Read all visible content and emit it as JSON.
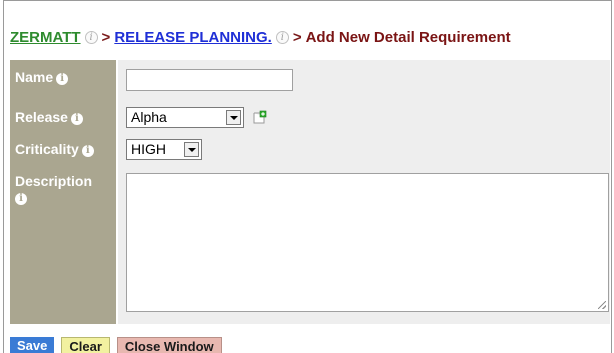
{
  "breadcrumb": {
    "project": "ZERMATT",
    "separator": ">",
    "module": "RELEASE PLANNING.",
    "current": "Add New Detail Requirement"
  },
  "form": {
    "name": {
      "label": "Name",
      "value": ""
    },
    "release": {
      "label": "Release",
      "selected": "Alpha"
    },
    "criticality": {
      "label": "Criticality",
      "selected": "HIGH"
    },
    "description": {
      "label": "Description",
      "value": ""
    }
  },
  "buttons": {
    "save": "Save",
    "clear": "Clear",
    "close": "Close Window"
  },
  "icons": {
    "info": "info-icon",
    "add": "add-release-icon",
    "dropdown": "chevron-down-icon"
  },
  "colors": {
    "label_bg": "#aaa690",
    "input_bg": "#eeeeee",
    "project_link": "#2e8b2e",
    "module_link": "#1f2fd6",
    "title": "#7a1414",
    "save_button": "#3a7bd5",
    "clear_button": "#f2f1a0",
    "close_button": "#e8b8b0"
  }
}
